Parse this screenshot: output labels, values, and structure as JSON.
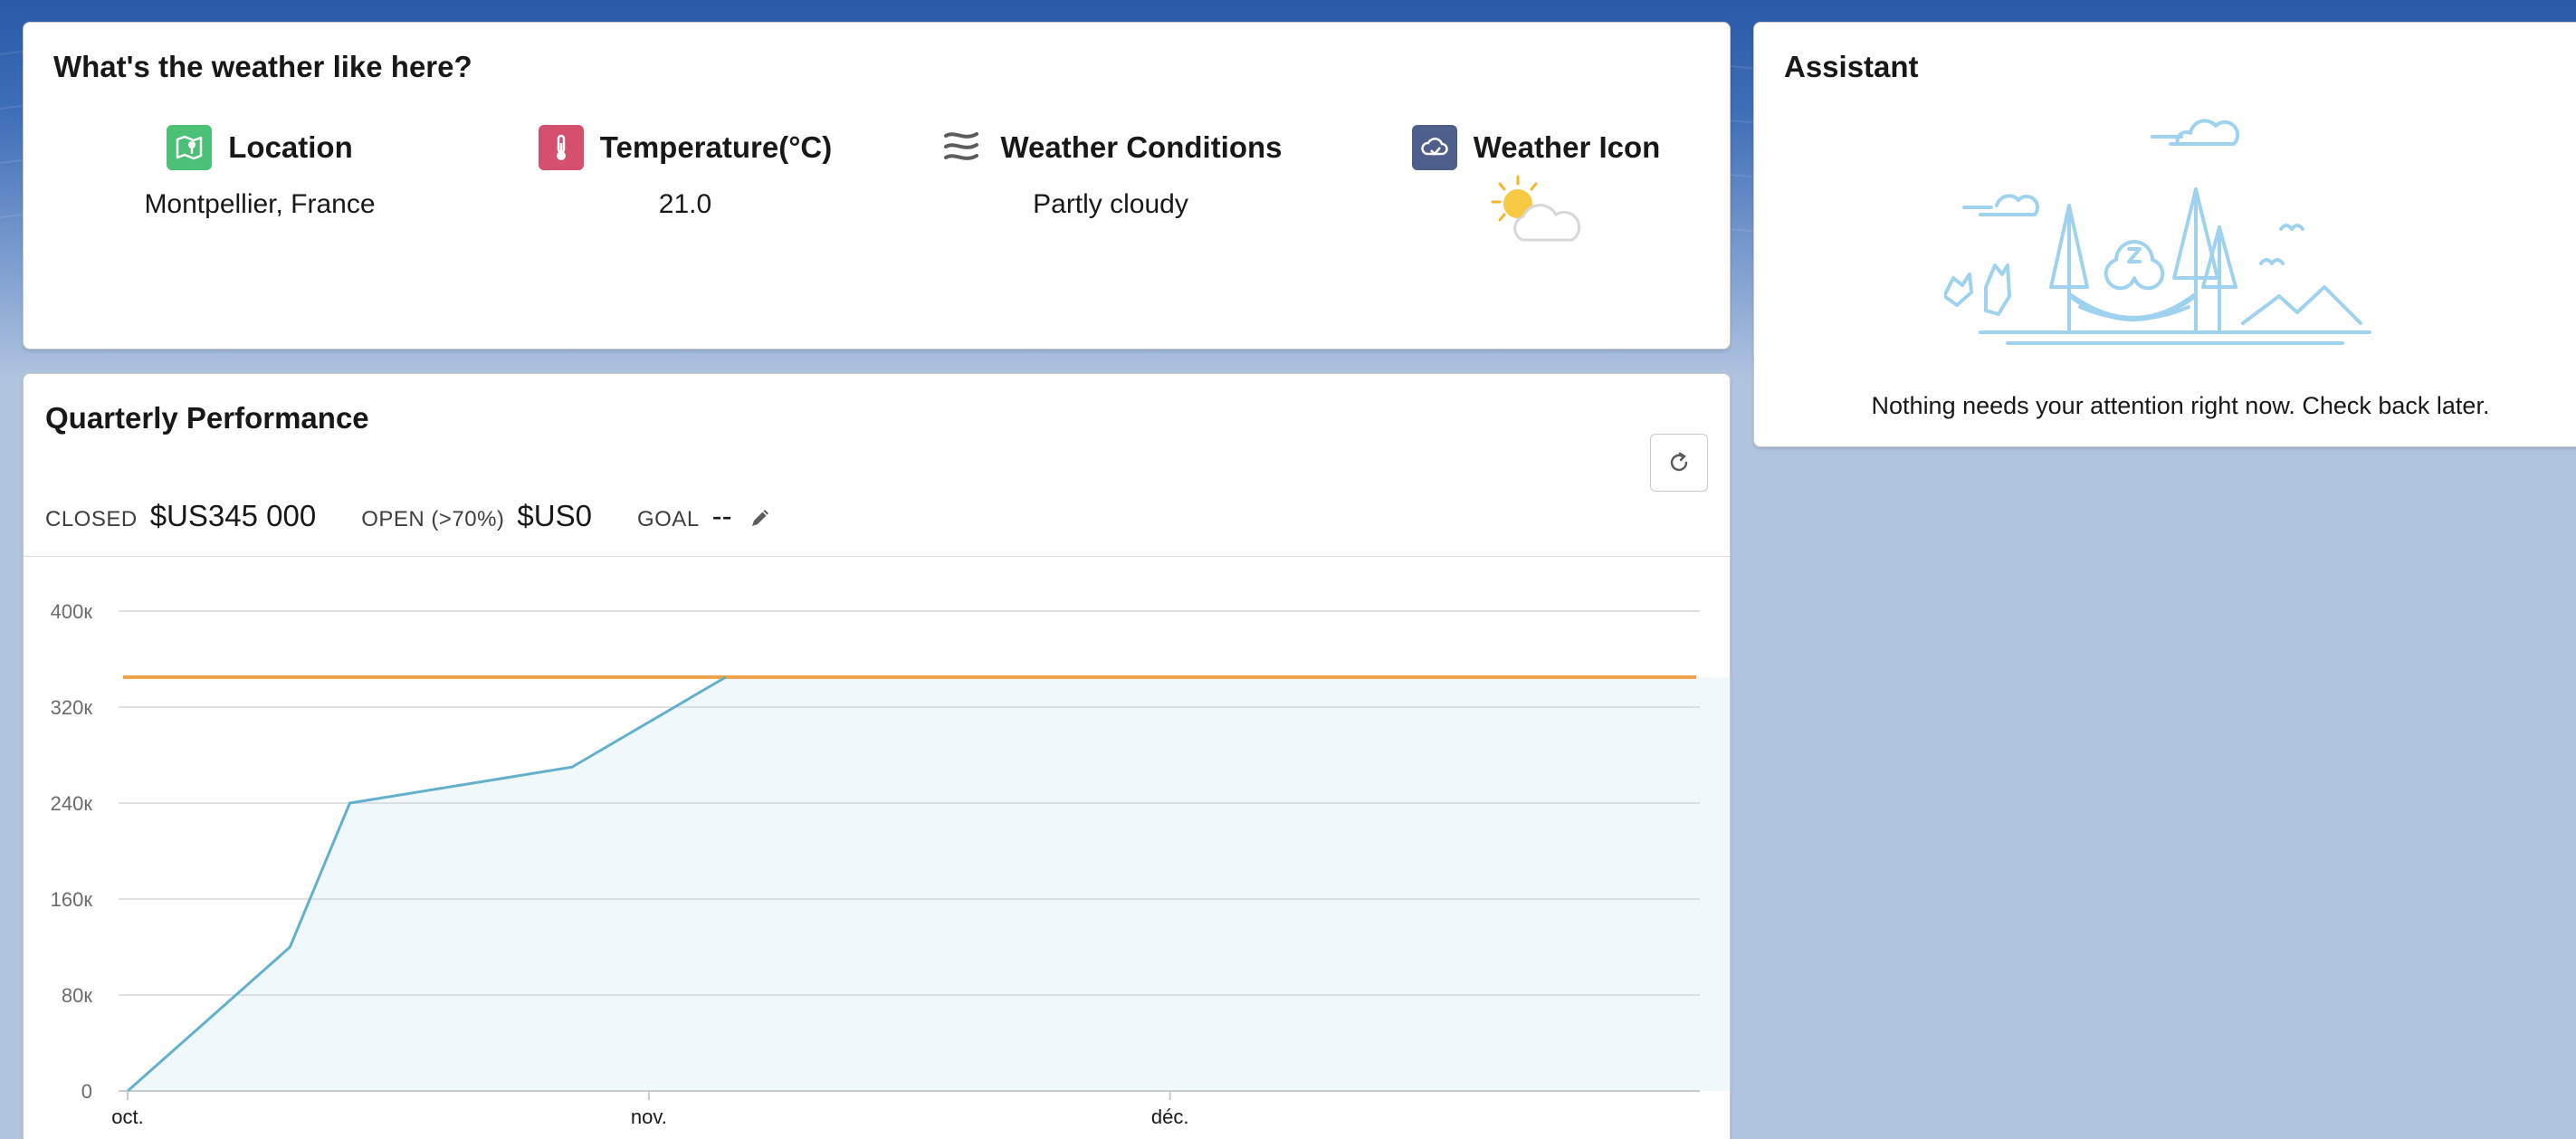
{
  "weather": {
    "title": "What's the weather like here?",
    "columns": [
      {
        "label": "Location",
        "value": "Montpellier, France",
        "icon": "map-icon",
        "icon_color": "#4bc076"
      },
      {
        "label": "Temperature(°C)",
        "value": "21.0",
        "icon": "thermometer-icon",
        "icon_color": "#d4506e"
      },
      {
        "label": "Weather Conditions",
        "value": "Partly cloudy",
        "icon": "wind-icon",
        "icon_color": "#5c5c5c"
      },
      {
        "label": "Weather Icon",
        "value": "",
        "icon": "cloud-icon",
        "icon_color": "#4e5f8b"
      }
    ]
  },
  "performance": {
    "title": "Quarterly Performance",
    "closed_label": "CLOSED",
    "closed_value": "$US345 000",
    "open_label": "OPEN (>70%)",
    "open_value": "$US0",
    "goal_label": "GOAL",
    "goal_value": "--",
    "accent_line_color": "#f0a24a",
    "series_color": "#63b0cc"
  },
  "chart_data": {
    "type": "area",
    "x_axis_ticks": [
      "oct.",
      "nov.",
      "déc."
    ],
    "y_axis_ticks": [
      "0",
      "80к",
      "160к",
      "240к",
      "320к",
      "400к"
    ],
    "ylim": [
      0,
      400000
    ],
    "series": [
      {
        "values_x_days": [
          0,
          9.5,
          13,
          26,
          35,
          35,
          100
        ],
        "values": [
          0,
          120000,
          240000,
          270000,
          345000,
          345000,
          345000
        ]
      }
    ],
    "goal_line_value": 345000,
    "grid": true
  },
  "assistant": {
    "title": "Assistant",
    "message": "Nothing needs your attention right now. Check back later."
  }
}
